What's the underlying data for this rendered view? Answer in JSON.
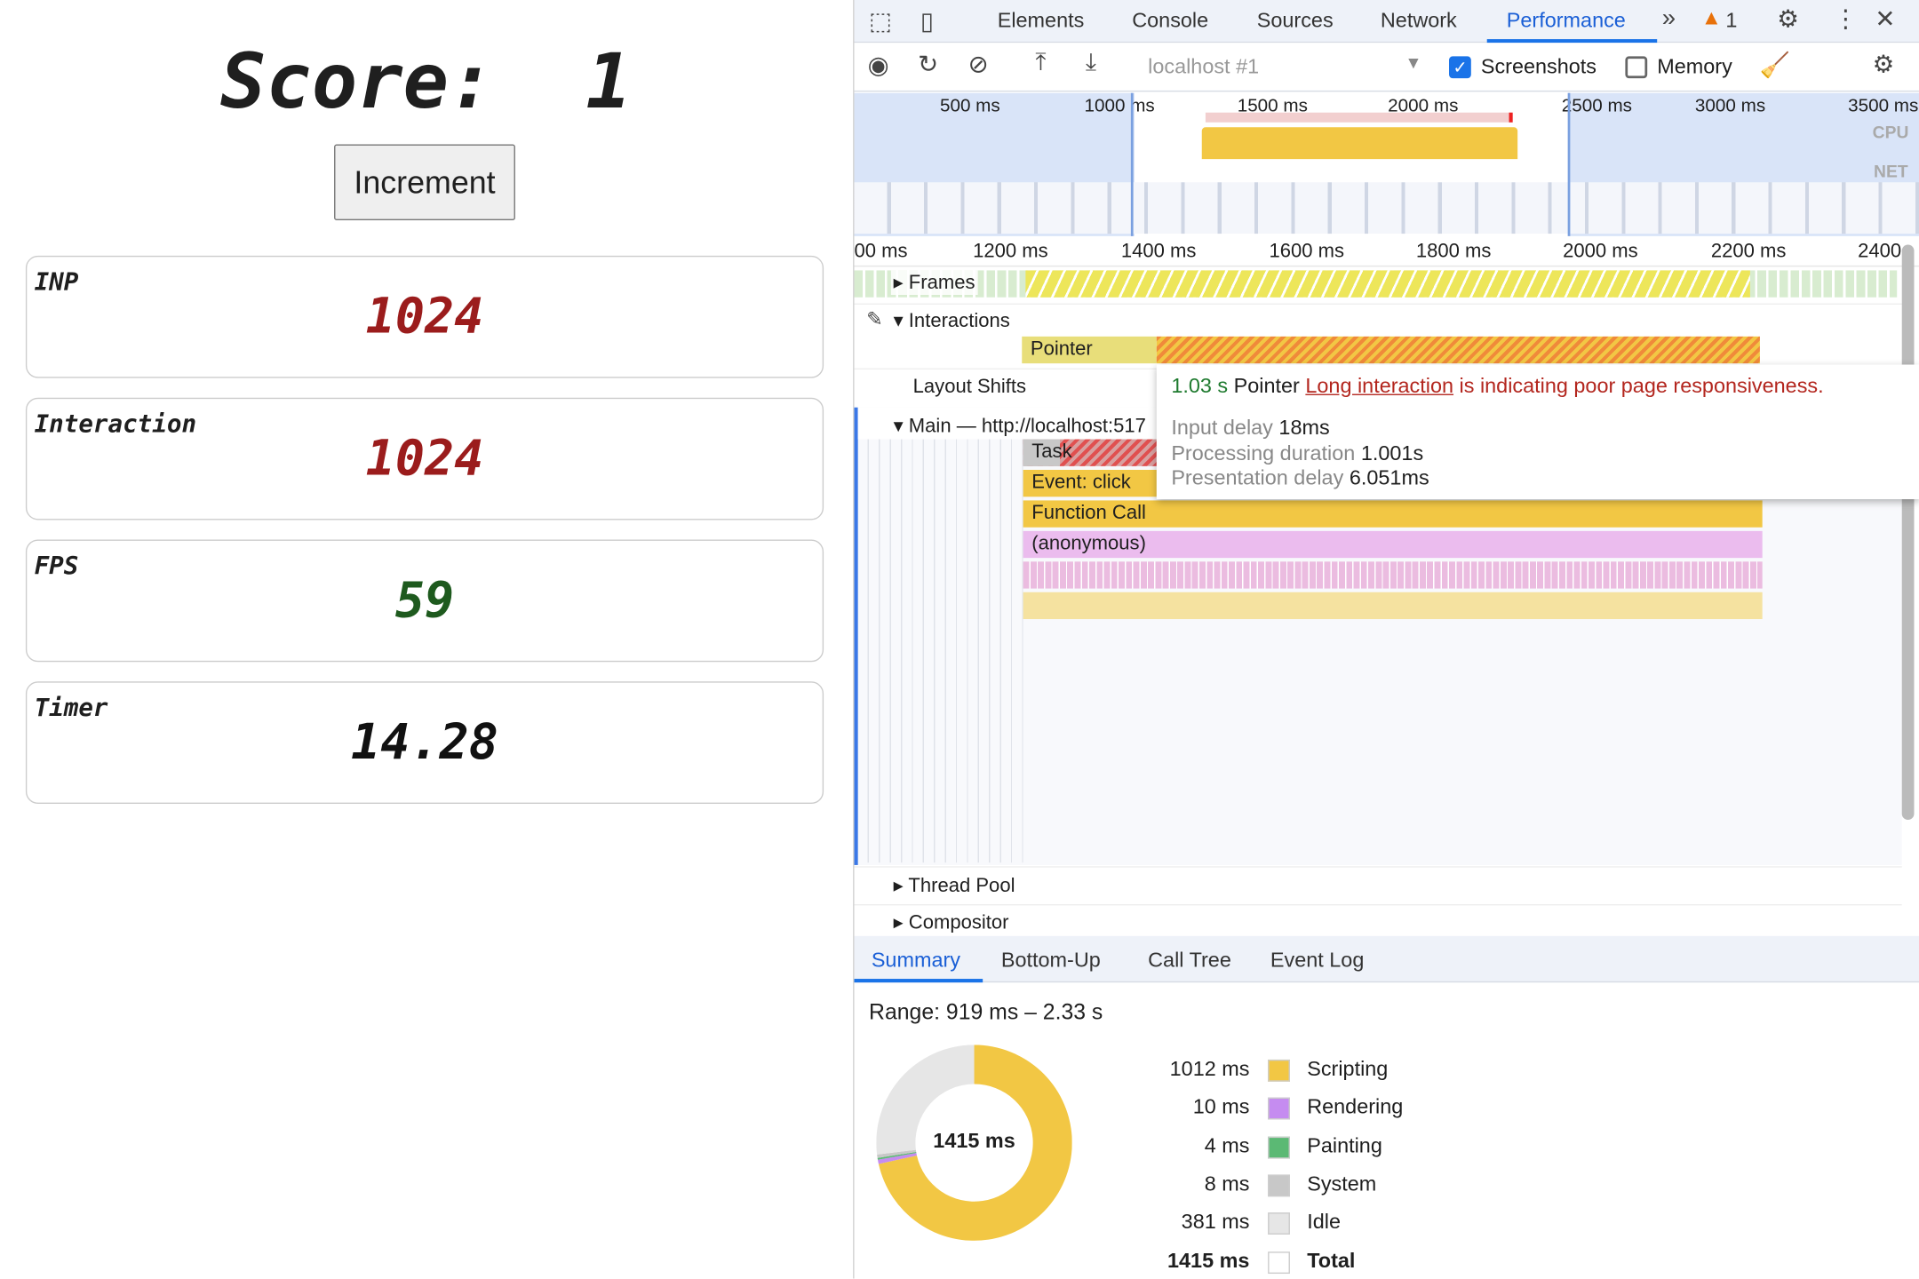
{
  "app": {
    "score_label": "Score:",
    "score_value": "1",
    "increment_label": "Increment",
    "cards": [
      {
        "label": "INP",
        "value": "1024",
        "color": "#9b1c1c"
      },
      {
        "label": "Interaction",
        "value": "1024",
        "color": "#9b1c1c"
      },
      {
        "label": "FPS",
        "value": "59",
        "color": "#1e5a1e"
      },
      {
        "label": "Timer",
        "value": "14.28",
        "color": "#111111"
      }
    ]
  },
  "devtools": {
    "tabs": [
      "Elements",
      "Console",
      "Sources",
      "Network",
      "Performance"
    ],
    "active_tab": "Performance",
    "warning_count": "1",
    "toolbar": {
      "target": "localhost #1",
      "screenshots_label": "Screenshots",
      "screenshots_checked": true,
      "memory_label": "Memory",
      "memory_checked": false
    },
    "overview": {
      "ticks": [
        "500 ms",
        "1000 ms",
        "1500 ms",
        "2000 ms",
        "2500 ms",
        "3000 ms",
        "3500 ms"
      ],
      "cpu_label": "CPU",
      "net_label": "NET"
    },
    "ruler": [
      "00 ms",
      "1200 ms",
      "1400 ms",
      "1600 ms",
      "1800 ms",
      "2000 ms",
      "2200 ms",
      "2400"
    ],
    "tracks": {
      "frames": "Frames",
      "interactions": "Interactions",
      "pointer": "Pointer",
      "layout_shifts": "Layout Shifts",
      "main": "Main — http://localhost:517",
      "task": "Task",
      "event_click": "Event: click",
      "function_call": "Function Call",
      "anonymous": "(anonymous)",
      "thread_pool": "Thread Pool",
      "compositor": "Compositor"
    },
    "tooltip": {
      "duration": "1.03 s",
      "type": "Pointer",
      "link": "Long interaction",
      "warning": " is indicating poor page responsiveness.",
      "rows": [
        {
          "label": "Input delay",
          "value": "18ms"
        },
        {
          "label": "Processing duration",
          "value": "1.001s"
        },
        {
          "label": "Presentation delay",
          "value": "6.051ms"
        }
      ]
    },
    "bottom_tabs": [
      "Summary",
      "Bottom-Up",
      "Call Tree",
      "Event Log"
    ],
    "summary": {
      "range": "Range: 919 ms – 2.33 s",
      "total_center": "1415 ms",
      "items": [
        {
          "ms": "1012 ms",
          "name": "Scripting",
          "color": "#f2c744",
          "value": 1012
        },
        {
          "ms": "10 ms",
          "name": "Rendering",
          "color": "#c58cf0",
          "value": 10
        },
        {
          "ms": "4 ms",
          "name": "Painting",
          "color": "#5bb974",
          "value": 4
        },
        {
          "ms": "8 ms",
          "name": "System",
          "color": "#c8c8c8",
          "value": 8
        },
        {
          "ms": "381 ms",
          "name": "Idle",
          "color": "#e6e6e6",
          "value": 381
        },
        {
          "ms": "1415 ms",
          "name": "Total",
          "color": "#ffffff",
          "value": 1415
        }
      ]
    }
  }
}
